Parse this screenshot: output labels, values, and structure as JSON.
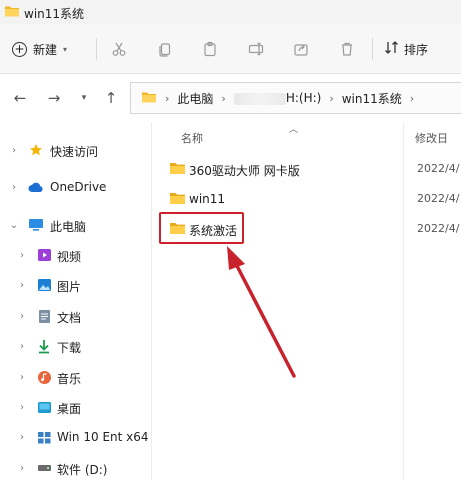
{
  "window": {
    "title": "win11系统"
  },
  "toolbar": {
    "new_label": "新建",
    "sort_label": "排序",
    "icons": [
      "cut-icon",
      "copy-icon",
      "paste-icon",
      "rename-icon",
      "share-icon",
      "delete-icon"
    ]
  },
  "address": {
    "crumbs": [
      "此电脑",
      "H:(H:)",
      "win11系统"
    ]
  },
  "sidebar": {
    "items": [
      {
        "label": "快速访问",
        "icon": "star-icon"
      },
      {
        "label": "OneDrive",
        "icon": "cloud-icon"
      },
      {
        "label": "此电脑",
        "icon": "computer-icon"
      },
      {
        "label": "视频",
        "icon": "video-icon"
      },
      {
        "label": "图片",
        "icon": "pictures-icon"
      },
      {
        "label": "文档",
        "icon": "documents-icon"
      },
      {
        "label": "下载",
        "icon": "download-icon"
      },
      {
        "label": "音乐",
        "icon": "music-icon"
      },
      {
        "label": "桌面",
        "icon": "desktop-icon"
      },
      {
        "label": "Win 10 Ent x64 (",
        "icon": "drive-icon"
      },
      {
        "label": "软件 (D:)",
        "icon": "drive-icon"
      }
    ]
  },
  "content": {
    "columns": {
      "name": "名称",
      "date": "修改日"
    },
    "files": [
      {
        "name": "360驱动大师 网卡版",
        "date": "2022/4/"
      },
      {
        "name": "win11",
        "date": "2022/4/"
      },
      {
        "name": "系统激活",
        "date": "2022/4/"
      }
    ]
  },
  "colors": {
    "accent": "#d0202a",
    "folder": "#f5c242"
  }
}
